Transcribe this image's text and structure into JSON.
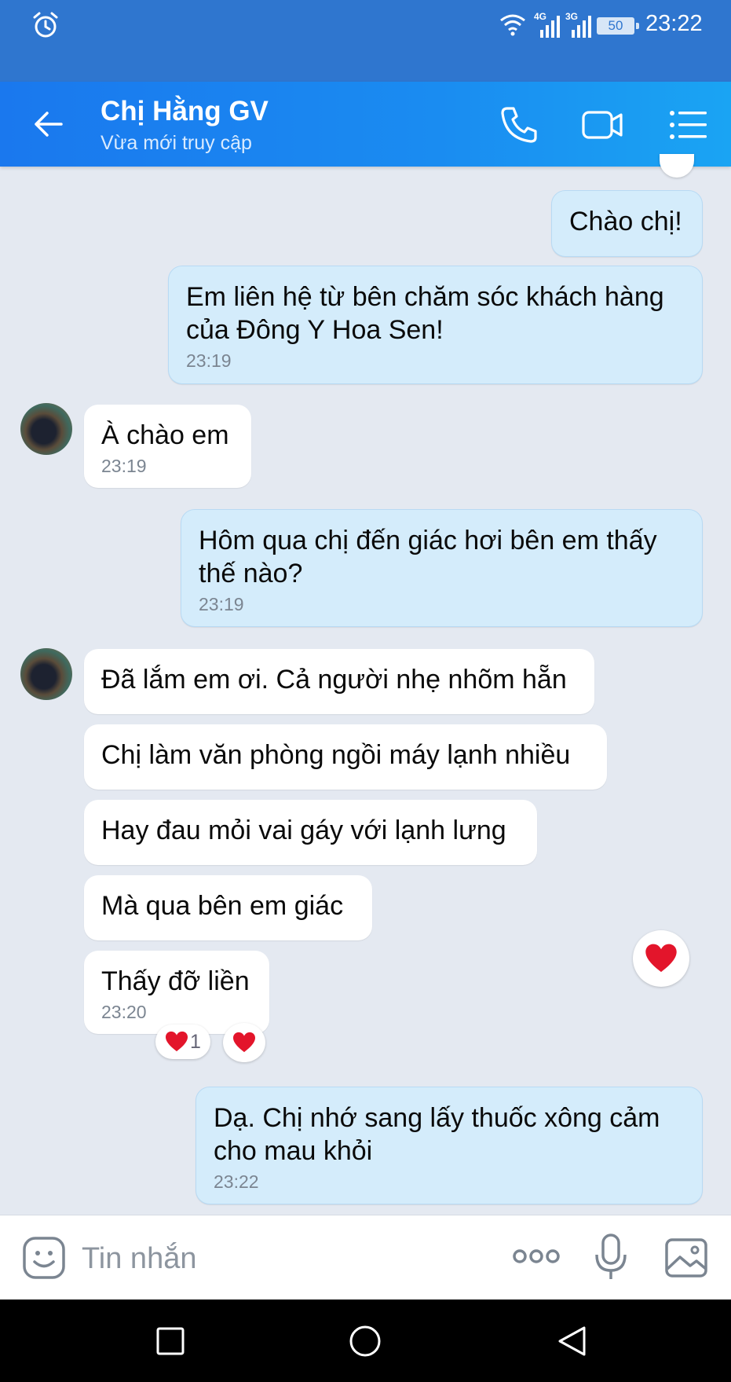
{
  "status_bar": {
    "net1": "4G",
    "net2": "3G",
    "battery": "50",
    "time": "23:22"
  },
  "header": {
    "contact_name": "Chị Hằng GV",
    "presence": "Vừa mới truy cập"
  },
  "messages": [
    {
      "dir": "out",
      "text": "Chào chị!",
      "time": ""
    },
    {
      "dir": "out",
      "text": "Em liên hệ từ bên chăm sóc khách hàng của Đông Y Hoa Sen!",
      "time": "23:19"
    },
    {
      "dir": "in",
      "text": "À chào em",
      "time": "23:19"
    },
    {
      "dir": "out",
      "text": "Hôm qua chị đến giác hơi bên em thấy thế nào?",
      "time": "23:19"
    },
    {
      "dir": "in",
      "text": "Đã lắm em ơi. Cả người nhẹ nhõm hẵn",
      "time": ""
    },
    {
      "dir": "in",
      "text": "Chị làm văn phòng ngồi máy lạnh nhiều",
      "time": ""
    },
    {
      "dir": "in",
      "text": "Hay đau mỏi vai gáy với lạnh lưng",
      "time": ""
    },
    {
      "dir": "in",
      "text": "Mà qua bên em giác",
      "time": ""
    },
    {
      "dir": "in",
      "text": "Thấy đỡ liền",
      "time": "23:20"
    },
    {
      "dir": "out",
      "text": "Dạ. Chị nhớ sang lấy thuốc xông cảm cho mau khỏi",
      "time": "23:22"
    }
  ],
  "reactions": {
    "heart_count": "1"
  },
  "input": {
    "placeholder": "Tin nhắn"
  },
  "colors": {
    "header": "#1a8cf1",
    "outgoing_bubble": "#d4ecfb",
    "incoming_bubble": "#ffffff",
    "chat_bg": "#e4e9f1",
    "heart": "#e3152b"
  },
  "icons": [
    "alarm-icon",
    "wifi-icon",
    "signal-icon",
    "back-arrow-icon",
    "phone-icon",
    "video-call-icon",
    "menu-icon",
    "heart-icon",
    "sticker-icon",
    "more-icon",
    "microphone-icon",
    "image-icon",
    "recent-apps-icon",
    "home-icon",
    "back-nav-icon"
  ]
}
